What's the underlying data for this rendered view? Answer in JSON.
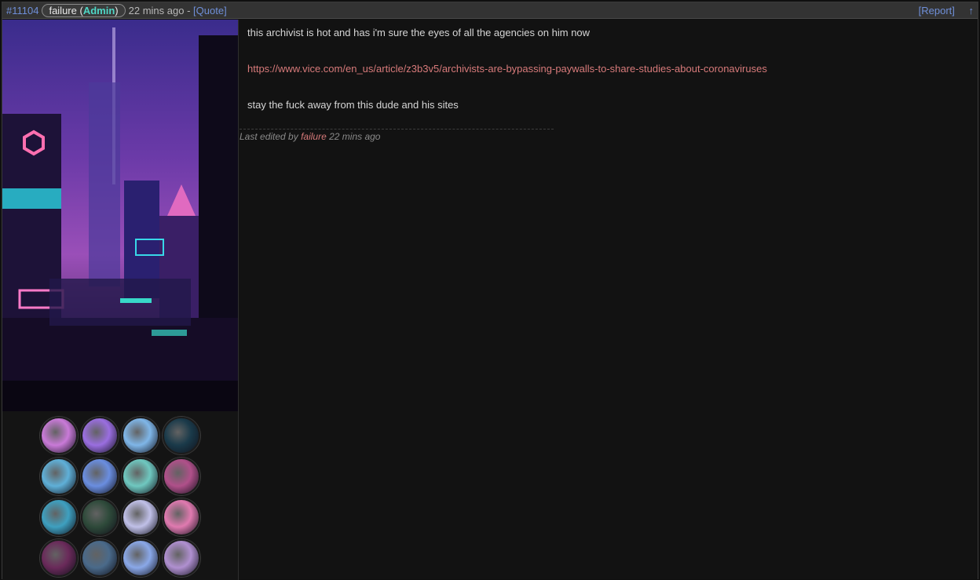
{
  "post": {
    "id": "#11104",
    "author": "failure",
    "role": "Admin",
    "time": "22 mins ago",
    "separator": "-",
    "quote_label": "[Quote]",
    "report_label": "[Report]",
    "up_label": "↑"
  },
  "body": {
    "line1": "this archivist is hot and has i'm sure the eyes of all the agencies on him now",
    "link": "https://www.vice.com/en_us/article/z3b3v5/archivists-are-bypassing-paywalls-to-share-studies-about-coronaviruses",
    "line3": "stay the fuck away from this dude and his sites"
  },
  "edit": {
    "prefix": "Last edited by",
    "editor": "failure",
    "time": "22 mins ago"
  },
  "colors": {
    "link": "#6f8fd8",
    "role": "#4fd7c6",
    "url": "#d77a7a",
    "background": "#121212"
  },
  "badges": [
    {
      "icon": "badge-1",
      "color": "#c97ad8"
    },
    {
      "icon": "badge-2",
      "color": "#9a6ee0"
    },
    {
      "icon": "badge-3",
      "color": "#7fb6e8"
    },
    {
      "icon": "badge-4",
      "color": "#1a3a4a"
    },
    {
      "icon": "badge-5",
      "color": "#5fb0d8"
    },
    {
      "icon": "badge-6",
      "color": "#6a8ee0"
    },
    {
      "icon": "badge-7",
      "color": "#6fc8c0"
    },
    {
      "icon": "badge-8",
      "color": "#b0508a"
    },
    {
      "icon": "badge-9",
      "color": "#3ea0c0"
    },
    {
      "icon": "badge-10",
      "color": "#2e4a3a"
    },
    {
      "icon": "badge-11",
      "color": "#c0c0e8"
    },
    {
      "icon": "badge-12",
      "color": "#e07ab0"
    },
    {
      "icon": "badge-13",
      "color": "#6a2a5a"
    },
    {
      "icon": "badge-14",
      "color": "#4a6a8a"
    },
    {
      "icon": "badge-15",
      "color": "#8aa8e8"
    },
    {
      "icon": "badge-16",
      "color": "#b090d0"
    }
  ]
}
